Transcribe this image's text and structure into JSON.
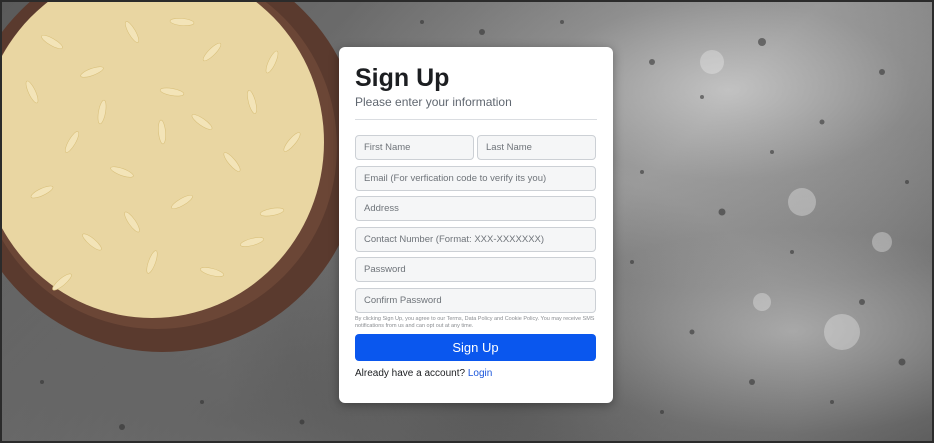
{
  "signup": {
    "title": "Sign Up",
    "subtitle": "Please enter your information",
    "fields": {
      "first_name": {
        "placeholder": "First Name",
        "value": ""
      },
      "last_name": {
        "placeholder": "Last Name",
        "value": ""
      },
      "email": {
        "placeholder": "Email (For verfication code to verify its you)",
        "value": ""
      },
      "address": {
        "placeholder": "Address",
        "value": ""
      },
      "contact_number": {
        "placeholder": "Contact Number (Format: XXX-XXXXXXX)",
        "value": ""
      },
      "password": {
        "placeholder": "Password",
        "value": ""
      },
      "confirm_password": {
        "placeholder": "Confirm Password",
        "value": ""
      }
    },
    "terms_text": "By clicking Sign Up, you agree to our Terms, Data Policy and Cookie Policy. You may receive SMS notifications from us and can opt out at any time.",
    "submit_label": "Sign Up",
    "login_prompt": "Already have a account?",
    "login_link": "Login"
  },
  "colors": {
    "button": "#0a57ee",
    "link": "#1a56db",
    "card": "#ffffff",
    "field_bg": "#f5f6f7"
  },
  "background": {
    "image": "bowl-of-rice-on-stone-surface"
  }
}
